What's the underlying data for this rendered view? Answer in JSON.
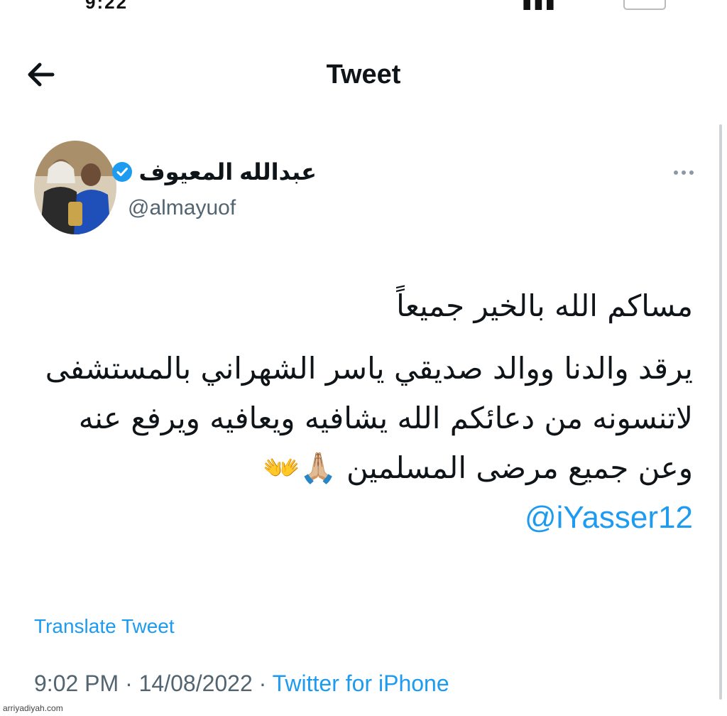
{
  "header": {
    "title": "Tweet"
  },
  "icons": {
    "back": "arrow-left-icon",
    "verified": "verified-badge-icon",
    "more": "more-dots-icon"
  },
  "colors": {
    "link_blue": "#1d9bf0",
    "text": "#0f1419",
    "secondary": "#536471"
  },
  "tweet": {
    "author": {
      "display_name": "عبدالله المعيوف",
      "handle": "@almayuof"
    },
    "lines": [
      "مساكم الله بالخير جميعاً",
      "يرقد والدنا ووالد صديقي ياسر الشهراني بالمستشفى",
      "لاتنسونه من دعائكم الله يشافيه ويعافيه ويرفع عنه",
      "وعن جميع مرضى المسلمين 🙏🏼👐"
    ],
    "mention": "@iYasser12",
    "translate_label": "Translate Tweet",
    "time": "9:02 PM",
    "date": "14/08/2022",
    "separator": "·",
    "source": "Twitter for iPhone"
  },
  "watermark": "arriyadiyah.com"
}
